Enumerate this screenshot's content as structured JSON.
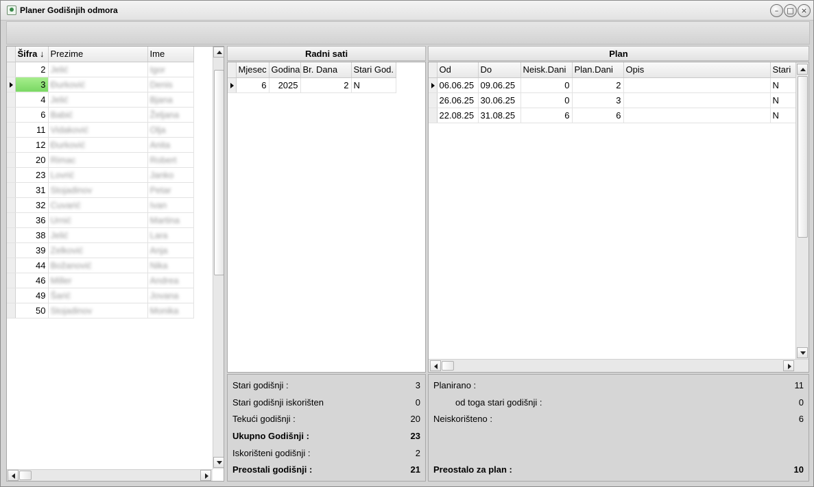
{
  "window": {
    "title": "Planer Godišnjih odmora",
    "minimize_glyph": "–",
    "maximize_glyph": "□",
    "close_glyph": "×"
  },
  "employees": {
    "columns": [
      "Šifra ↓",
      "Prezime",
      "Ime"
    ],
    "rows": [
      {
        "sifra": "2",
        "prezime": "Jelić",
        "ime": "Igor"
      },
      {
        "sifra": "3",
        "prezime": "Đurković",
        "ime": "Denis"
      },
      {
        "sifra": "4",
        "prezime": "Jelić",
        "ime": "Bjana"
      },
      {
        "sifra": "6",
        "prezime": "Babić",
        "ime": "Željana"
      },
      {
        "sifra": "11",
        "prezime": "Vidaković",
        "ime": "Olja"
      },
      {
        "sifra": "12",
        "prezime": "Đurković",
        "ime": "Anita"
      },
      {
        "sifra": "20",
        "prezime": "Rimac",
        "ime": "Robert"
      },
      {
        "sifra": "23",
        "prezime": "Lovrić",
        "ime": "Janko"
      },
      {
        "sifra": "31",
        "prezime": "Stojadinov",
        "ime": "Petar"
      },
      {
        "sifra": "32",
        "prezime": "Cuvarić",
        "ime": "Ivan"
      },
      {
        "sifra": "36",
        "prezime": "Urnić",
        "ime": "Martina"
      },
      {
        "sifra": "38",
        "prezime": "Jelić",
        "ime": "Lara"
      },
      {
        "sifra": "39",
        "prezime": "Zelković",
        "ime": "Anja"
      },
      {
        "sifra": "44",
        "prezime": "Božanović",
        "ime": "Nika"
      },
      {
        "sifra": "46",
        "prezime": "Miller",
        "ime": "Andrea"
      },
      {
        "sifra": "49",
        "prezime": "Šarić",
        "ime": "Jovana"
      },
      {
        "sifra": "50",
        "prezime": "Stojadinov",
        "ime": "Monika"
      }
    ],
    "selected_index": 1
  },
  "radni_sati": {
    "title": "Radni sati",
    "columns": [
      "Mjesec",
      "Godina",
      "Br. Dana",
      "Stari God."
    ],
    "rows": [
      {
        "mjesec": "6",
        "godina": "2025",
        "br_dana": "2",
        "stari": "N"
      }
    ]
  },
  "plan": {
    "title": "Plan",
    "columns": [
      "Od",
      "Do",
      "Neisk.Dani",
      "Plan.Dani",
      "Opis",
      "Stari"
    ],
    "rows": [
      {
        "od": "06.06.25",
        "do": "09.06.25",
        "neisk": "0",
        "plan": "2",
        "opis": "",
        "stari": "N"
      },
      {
        "od": "26.06.25",
        "do": "30.06.25",
        "neisk": "0",
        "plan": "3",
        "opis": "",
        "stari": "N"
      },
      {
        "od": "22.08.25",
        "do": "31.08.25",
        "neisk": "6",
        "plan": "6",
        "opis": "",
        "stari": "N"
      }
    ]
  },
  "summary_left": [
    {
      "label": "Stari godišnji :",
      "value": "3",
      "bold": false
    },
    {
      "label": "Stari godišnji iskorišten",
      "value": "0",
      "bold": false
    },
    {
      "label": "Tekući godišnji :",
      "value": "20",
      "bold": false
    },
    {
      "label": "Ukupno Godišnji :",
      "value": "23",
      "bold": true
    },
    {
      "label": "Iskorišteni godišnji :",
      "value": "2",
      "bold": false
    },
    {
      "label": "Preostali godišnji :",
      "value": "21",
      "bold": true
    }
  ],
  "summary_right": [
    {
      "label": "Planirano :",
      "value": "11",
      "bold": false
    },
    {
      "label": "od toga stari godišnji :",
      "value": "0",
      "bold": false
    },
    {
      "label": "Neiskorišteno :",
      "value": "6",
      "bold": false
    },
    {
      "label": "Preostalo za plan :",
      "value": "10",
      "bold": true
    }
  ]
}
